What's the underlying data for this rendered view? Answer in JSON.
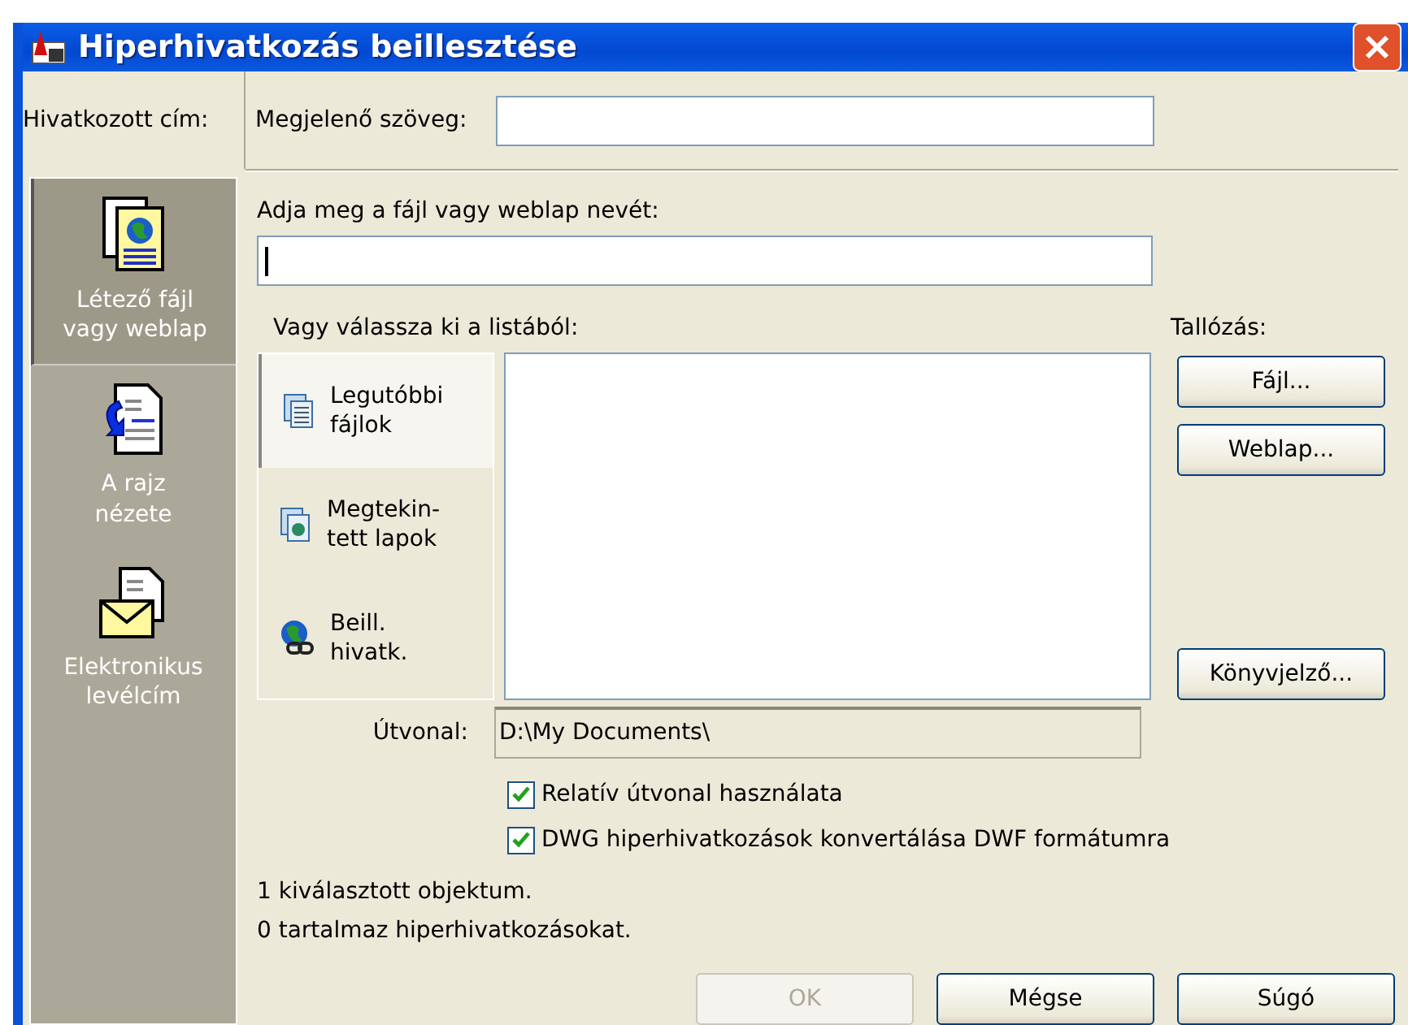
{
  "window": {
    "title": "Hiperhivatkozás beillesztése"
  },
  "link_to_label": "Hivatkozott cím:",
  "display_text": {
    "label": "Megjelenő szöveg:"
  },
  "sidebar": {
    "items": [
      {
        "label": "Létező fájl\nvagy weblap",
        "kind": "file",
        "selected": true
      },
      {
        "label": "A rajz\nnézete",
        "kind": "view",
        "selected": false
      },
      {
        "label": "Elektronikus\nlevélcím",
        "kind": "email",
        "selected": false
      }
    ]
  },
  "file_name": {
    "label": "Adja meg a fájl vagy weblap nevét:"
  },
  "list_label": "Vagy válassza ki a listából:",
  "list_tabs": [
    {
      "label": "Legutóbbi\nfájlok",
      "kind": "recent",
      "selected": true
    },
    {
      "label": "Megtekin-\ntett lapok",
      "kind": "browsed",
      "selected": false
    },
    {
      "label": "Beill.\nhivatk.",
      "kind": "inserted",
      "selected": false
    }
  ],
  "browse": {
    "label": "Tallózás:",
    "buttons": [
      {
        "label": "Fájl...",
        "kind": "file"
      },
      {
        "label": "Weblap...",
        "kind": "web"
      },
      {
        "label": "Könyvjelző...",
        "kind": "bookmark"
      }
    ]
  },
  "path": {
    "label": "Útvonal:",
    "value": "D:\\My Documents\\"
  },
  "options": [
    {
      "label": "Relatív útvonal használata",
      "checked": true
    },
    {
      "label": "DWG hiperhivatkozások konvertálása DWF formátumra",
      "checked": true
    }
  ],
  "status": [
    "1 kiválasztott objektum.",
    "0 tartalmaz hiperhivatkozásokat."
  ],
  "buttons": [
    {
      "label": "OK",
      "disabled": true
    },
    {
      "label": "Mégse",
      "disabled": false
    },
    {
      "label": "Súgó",
      "disabled": false
    }
  ]
}
